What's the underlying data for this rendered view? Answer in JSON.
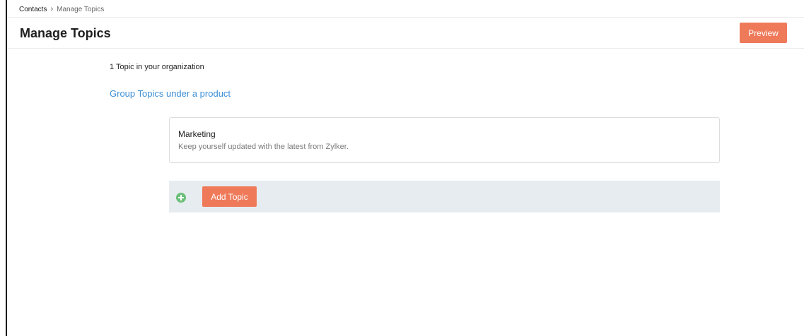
{
  "breadcrumb": {
    "root": "Contacts",
    "separator": "›",
    "current": "Manage Topics"
  },
  "header": {
    "title": "Manage Topics",
    "preview_label": "Preview"
  },
  "main": {
    "topic_count": "1 Topic in your organization",
    "group_link": "Group Topics under a product",
    "topics": [
      {
        "name": "Marketing",
        "description": "Keep yourself updated with the latest from Zylker."
      }
    ],
    "add_topic_label": "Add Topic"
  },
  "icons": {
    "add": "plus-circle-icon",
    "breadcrumb_separator": "chevron-right-icon"
  },
  "colors": {
    "accent": "#ee7a5a",
    "link": "#3d8fd6",
    "add_icon": "#6cc07a",
    "add_bar": "#e7ecf0"
  }
}
